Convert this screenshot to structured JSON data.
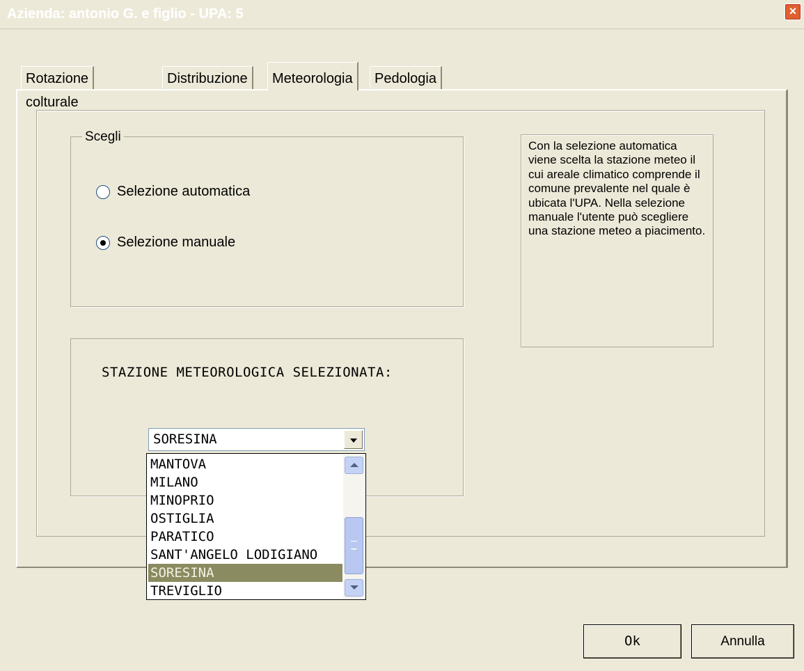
{
  "window": {
    "title": "Azienda: antonio G. e figlio - UPA: 5",
    "close_glyph": "×"
  },
  "tabs": [
    {
      "label": "Rotazione colturale",
      "active": false
    },
    {
      "label": "Distribuzione",
      "active": false
    },
    {
      "label": "Meteorologia",
      "active": true
    },
    {
      "label": "Pedologia",
      "active": false
    }
  ],
  "scegli": {
    "label": "Scegli",
    "options": [
      {
        "label": "Selezione automatica",
        "selected": false
      },
      {
        "label": "Selezione manuale",
        "selected": true
      }
    ]
  },
  "info_text": "Con la selezione automatica viene scelta la stazione meteo il cui areale climatico comprende il comune prevalente nel quale è ubicata l'UPA. Nella selezione manuale l'utente può scegliere una stazione meteo a piacimento.",
  "stazione": {
    "label": "STAZIONE METEOROLOGICA SELEZIONATA:",
    "selected": "SORESINA",
    "options": [
      "MANTOVA",
      "MILANO",
      "MINOPRIO",
      "OSTIGLIA",
      "PARATICO",
      "SANT'ANGELO LODIGIANO",
      "SORESINA",
      "TREVIGLIO"
    ],
    "scroll_position": 0.8
  },
  "buttons": {
    "ok": "Ok",
    "cancel": "Annulla"
  },
  "colors": {
    "face": "#ece9d8",
    "selection": "#8a8b60",
    "close": "#e0602f"
  }
}
